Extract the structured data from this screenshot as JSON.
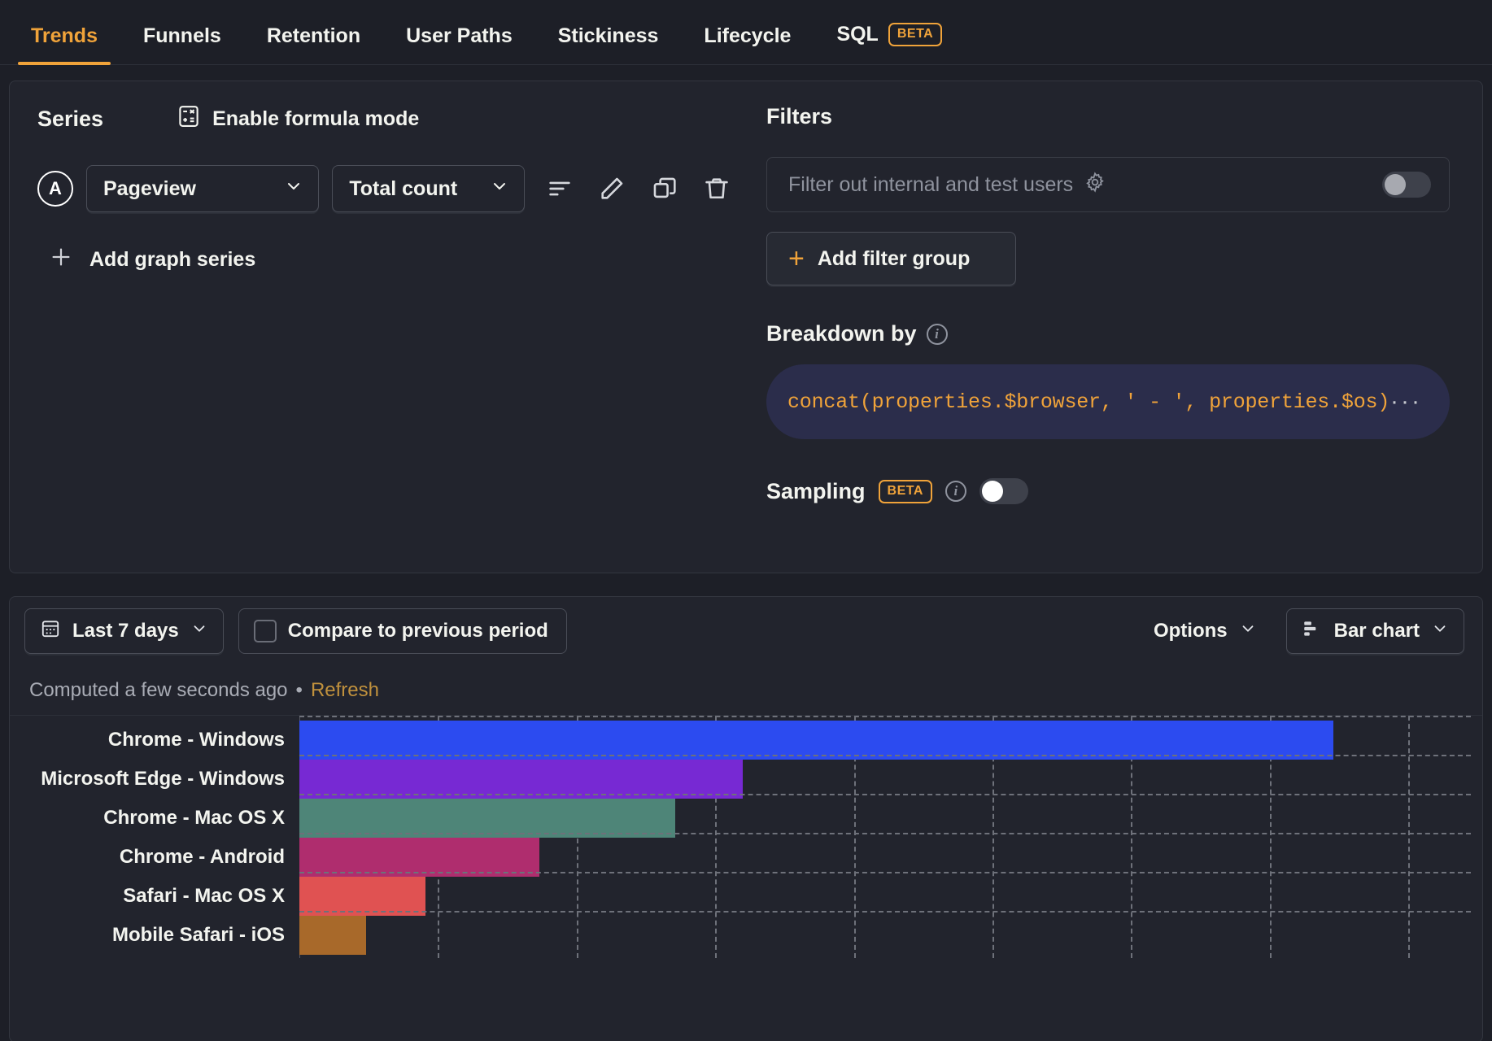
{
  "tabs": [
    {
      "label": "Trends",
      "active": true
    },
    {
      "label": "Funnels",
      "active": false
    },
    {
      "label": "Retention",
      "active": false
    },
    {
      "label": "User Paths",
      "active": false
    },
    {
      "label": "Stickiness",
      "active": false
    },
    {
      "label": "Lifecycle",
      "active": false
    },
    {
      "label": "SQL",
      "active": false,
      "badge": "BETA"
    }
  ],
  "series": {
    "title": "Series",
    "formula_mode_label": "Enable formula mode",
    "badge": "A",
    "event": "Pageview",
    "math": "Total count",
    "actions": [
      "filter-icon",
      "edit-icon",
      "duplicate-icon",
      "delete-icon"
    ],
    "add_series_label": "Add graph series"
  },
  "filters": {
    "title": "Filters",
    "internal_users_label": "Filter out internal and test users",
    "internal_users_enabled": false,
    "add_filter_group_label": "Add filter group"
  },
  "breakdown": {
    "title": "Breakdown by",
    "expression": "concat(properties.$browser, ' - ', properties.$os)",
    "more_label": "···"
  },
  "sampling": {
    "title": "Sampling",
    "badge": "BETA",
    "enabled": false
  },
  "toolbar": {
    "date_range": "Last 7 days",
    "compare_label": "Compare to previous period",
    "compare_checked": false,
    "options_label": "Options",
    "chart_type": "Bar chart"
  },
  "status": {
    "computed_text": "Computed a few seconds ago",
    "separator": "•",
    "refresh_label": "Refresh"
  },
  "chart_data": {
    "type": "bar",
    "orientation": "horizontal",
    "title": "",
    "xlabel": "",
    "ylabel": "",
    "grid": true,
    "legend": "none",
    "xlim": [
      0,
      10000
    ],
    "gridline_step": 1200,
    "categories": [
      "Chrome - Windows",
      "Microsoft Edge - Windows",
      "Chrome - Mac OS X",
      "Chrome - Android",
      "Safari - Mac OS X",
      "Mobile Safari - iOS"
    ],
    "values": [
      8950,
      3840,
      3250,
      2080,
      1090,
      580
    ],
    "colors": [
      "#2c4bf0",
      "#7729d3",
      "#4e8578",
      "#af2d6e",
      "#e05252",
      "#a8692a"
    ]
  }
}
